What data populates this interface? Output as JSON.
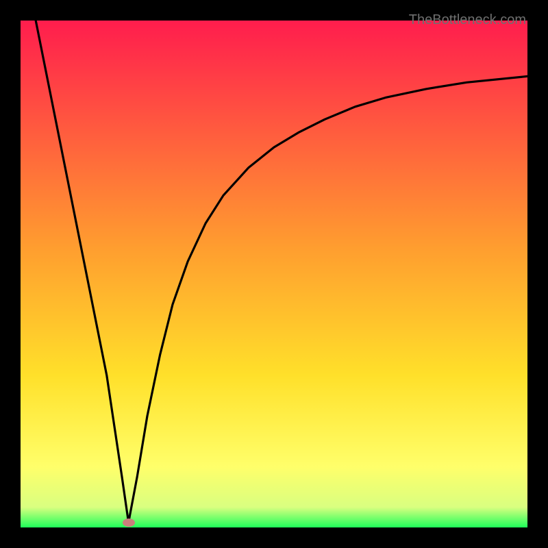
{
  "watermark": "TheBottleneck.com",
  "marker": {
    "x_pct": 21.3,
    "y_pct_from_top": 99.0
  },
  "chart_data": {
    "type": "line",
    "title": "",
    "xlabel": "",
    "ylabel": "",
    "xlim": [
      0,
      100
    ],
    "ylim": [
      0,
      100
    ],
    "grid": false,
    "background_gradient": [
      {
        "pos": 0.0,
        "color": "#ff1d4d"
      },
      {
        "pos": 0.45,
        "color": "#ff9e2f"
      },
      {
        "pos": 0.7,
        "color": "#ffe02a"
      },
      {
        "pos": 0.88,
        "color": "#ffff6a"
      },
      {
        "pos": 0.96,
        "color": "#d9ff80"
      },
      {
        "pos": 1.0,
        "color": "#1eff5a"
      }
    ],
    "series": [
      {
        "name": "left-branch",
        "x": [
          3.0,
          5.0,
          7.0,
          9.0,
          11.0,
          13.0,
          15.0,
          17.0,
          18.5,
          20.0,
          21.3
        ],
        "y": [
          100,
          90.0,
          80.0,
          70.0,
          60.0,
          50.0,
          40.0,
          30.0,
          20.0,
          10.0,
          1.0
        ]
      },
      {
        "name": "right-branch",
        "x": [
          21.3,
          23.0,
          25.0,
          27.5,
          30.0,
          33.0,
          36.5,
          40.0,
          45.0,
          50.0,
          55.0,
          60.0,
          66.0,
          72.0,
          80.0,
          88.0,
          100.0
        ],
        "y": [
          1.0,
          10.0,
          22.0,
          34.0,
          44.0,
          52.5,
          60.0,
          65.5,
          71.0,
          75.0,
          78.0,
          80.5,
          83.0,
          84.8,
          86.5,
          87.8,
          89.0
        ]
      }
    ],
    "marker_point": {
      "x": 21.3,
      "y": 1.0,
      "color": "#ca7f7c"
    },
    "notes": "y represents a bottleneck-style metric (0 = ideal at the dip). Values are estimated from the plot; no axis ticks are shown."
  }
}
